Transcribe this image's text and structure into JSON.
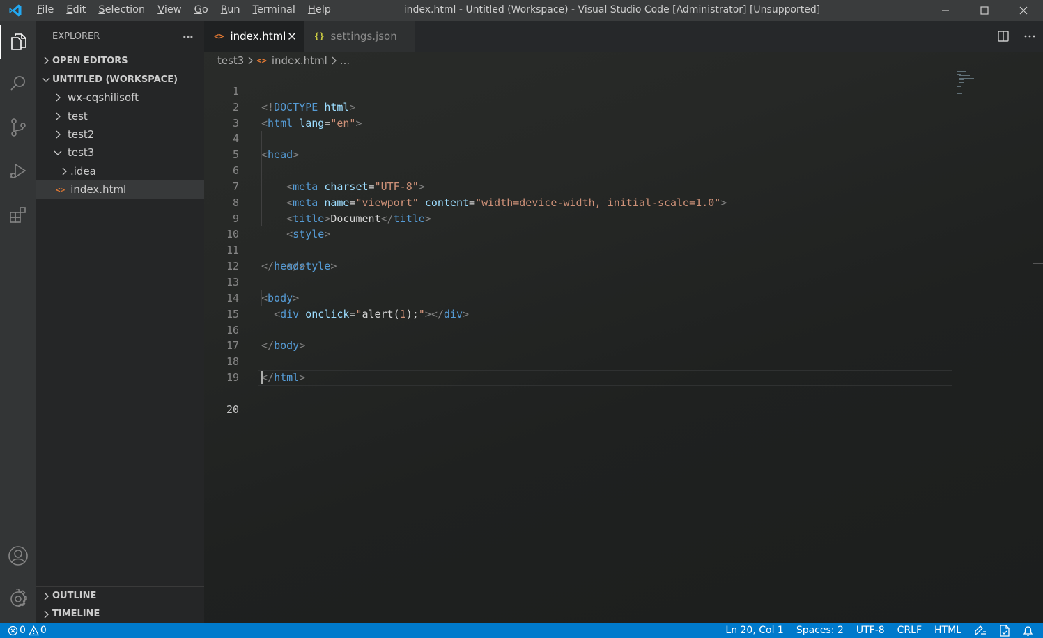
{
  "window": {
    "title": "index.html - Untitled (Workspace) - Visual Studio Code [Administrator] [Unsupported]"
  },
  "menu": [
    {
      "pre": "",
      "acc": "F",
      "post": "ile"
    },
    {
      "pre": "",
      "acc": "E",
      "post": "dit"
    },
    {
      "pre": "",
      "acc": "S",
      "post": "election"
    },
    {
      "pre": "",
      "acc": "V",
      "post": "iew"
    },
    {
      "pre": "",
      "acc": "G",
      "post": "o"
    },
    {
      "pre": "",
      "acc": "R",
      "post": "un"
    },
    {
      "pre": "",
      "acc": "T",
      "post": "erminal"
    },
    {
      "pre": "",
      "acc": "H",
      "post": "elp"
    }
  ],
  "sidebar": {
    "title": "EXPLORER",
    "more": "···",
    "open_editors": "OPEN EDITORS",
    "workspace": "UNTITLED (WORKSPACE)",
    "tree": {
      "wx": "wx-cqshilisoft",
      "test": "test",
      "test2": "test2",
      "test3": "test3",
      "idea": ".idea",
      "index": "index.html"
    },
    "outline": "OUTLINE",
    "timeline": "TIMELINE"
  },
  "tabs": {
    "active": {
      "icon": "<>",
      "label": "index.html"
    },
    "inactive": {
      "icon": "{}",
      "label": "settings.json"
    }
  },
  "breadcrumb": {
    "folder": "test3",
    "file_icon": "<>",
    "file": "index.html",
    "tail": "..."
  },
  "editor": {
    "line_numbers": [
      "1",
      "2",
      "3",
      "4",
      "5",
      "6",
      "7",
      "8",
      "9",
      "10",
      "11",
      "12",
      "13",
      "14",
      "15",
      "16",
      "17",
      "18",
      "19",
      "20"
    ],
    "current_line": 20
  },
  "status": {
    "errors": "0",
    "warnings": "0",
    "position": "Ln 20, Col 1",
    "spaces": "Spaces: 2",
    "encoding": "UTF-8",
    "eol": "CRLF",
    "language": "HTML"
  },
  "colors": {
    "status_bar": "#007acc",
    "accent_icon_html": "#e37933",
    "accent_icon_json": "#cbcb41"
  }
}
